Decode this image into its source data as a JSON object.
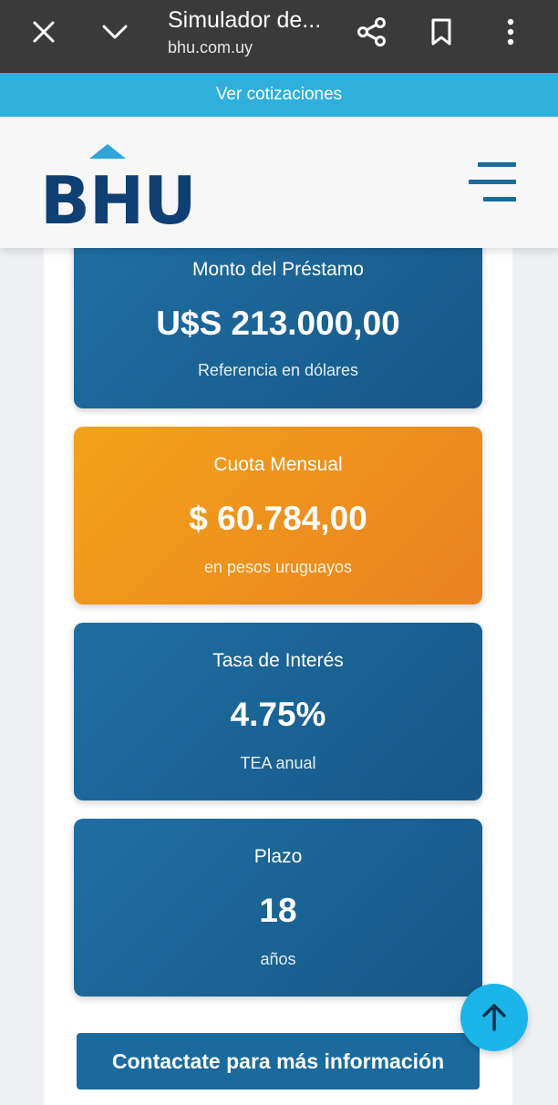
{
  "browser": {
    "title": "Simulador de...",
    "url": "bhu.com.uy",
    "icons": [
      "close-icon",
      "chevron-down-icon",
      "share-icon",
      "bookmark-icon",
      "more-vert-icon"
    ]
  },
  "quote_bar": {
    "label": "Ver cotizaciones"
  },
  "header": {
    "logo_text": "BHU",
    "menu_icon": "hamburger-menu-icon"
  },
  "cards": {
    "monto": {
      "label": "Monto del Préstamo",
      "value": "U$S 213.000,00",
      "sub": "Referencia en dólares"
    },
    "cuota": {
      "label": "Cuota Mensual",
      "value": "$ 60.784,00",
      "sub": "en pesos uruguayos"
    },
    "tasa": {
      "label": "Tasa de Interés",
      "value": "4.75%",
      "sub": "TEA anual"
    },
    "plazo": {
      "label": "Plazo",
      "value": "18",
      "sub": "años"
    }
  },
  "contact_button": {
    "label": "Contactate para más información"
  },
  "scroll_top": {
    "icon": "arrow-up-icon"
  },
  "colors": {
    "brand_blue": "#155987",
    "accent_orange": "#f4a21a",
    "quote_bar": "#2fb0dc",
    "scroll_top": "#1ab6ea"
  }
}
